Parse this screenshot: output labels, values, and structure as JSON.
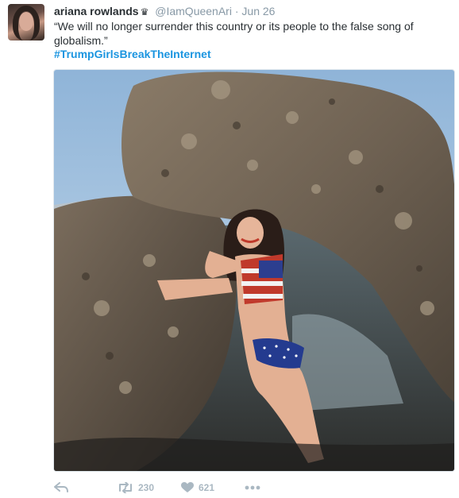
{
  "tweet": {
    "author_name": "ariana rowlands",
    "verified_icon": "crown-icon",
    "handle": "@IamQueenAri",
    "separator": "·",
    "date": "Jun 26",
    "text": "“We will no longer surrender this country or its people to the false song of globalism.”",
    "hashtag": "#TrumpGirlsBreakTheInternet"
  },
  "actions": {
    "reply_icon": "reply-icon",
    "retweet_icon": "retweet-icon",
    "retweet_count": "230",
    "like_icon": "heart-icon",
    "like_count": "621",
    "more_icon": "more-icon"
  },
  "colors": {
    "text": "#292f33",
    "muted": "#8899a6",
    "link": "#1b95e0",
    "action": "#aab8c2"
  }
}
